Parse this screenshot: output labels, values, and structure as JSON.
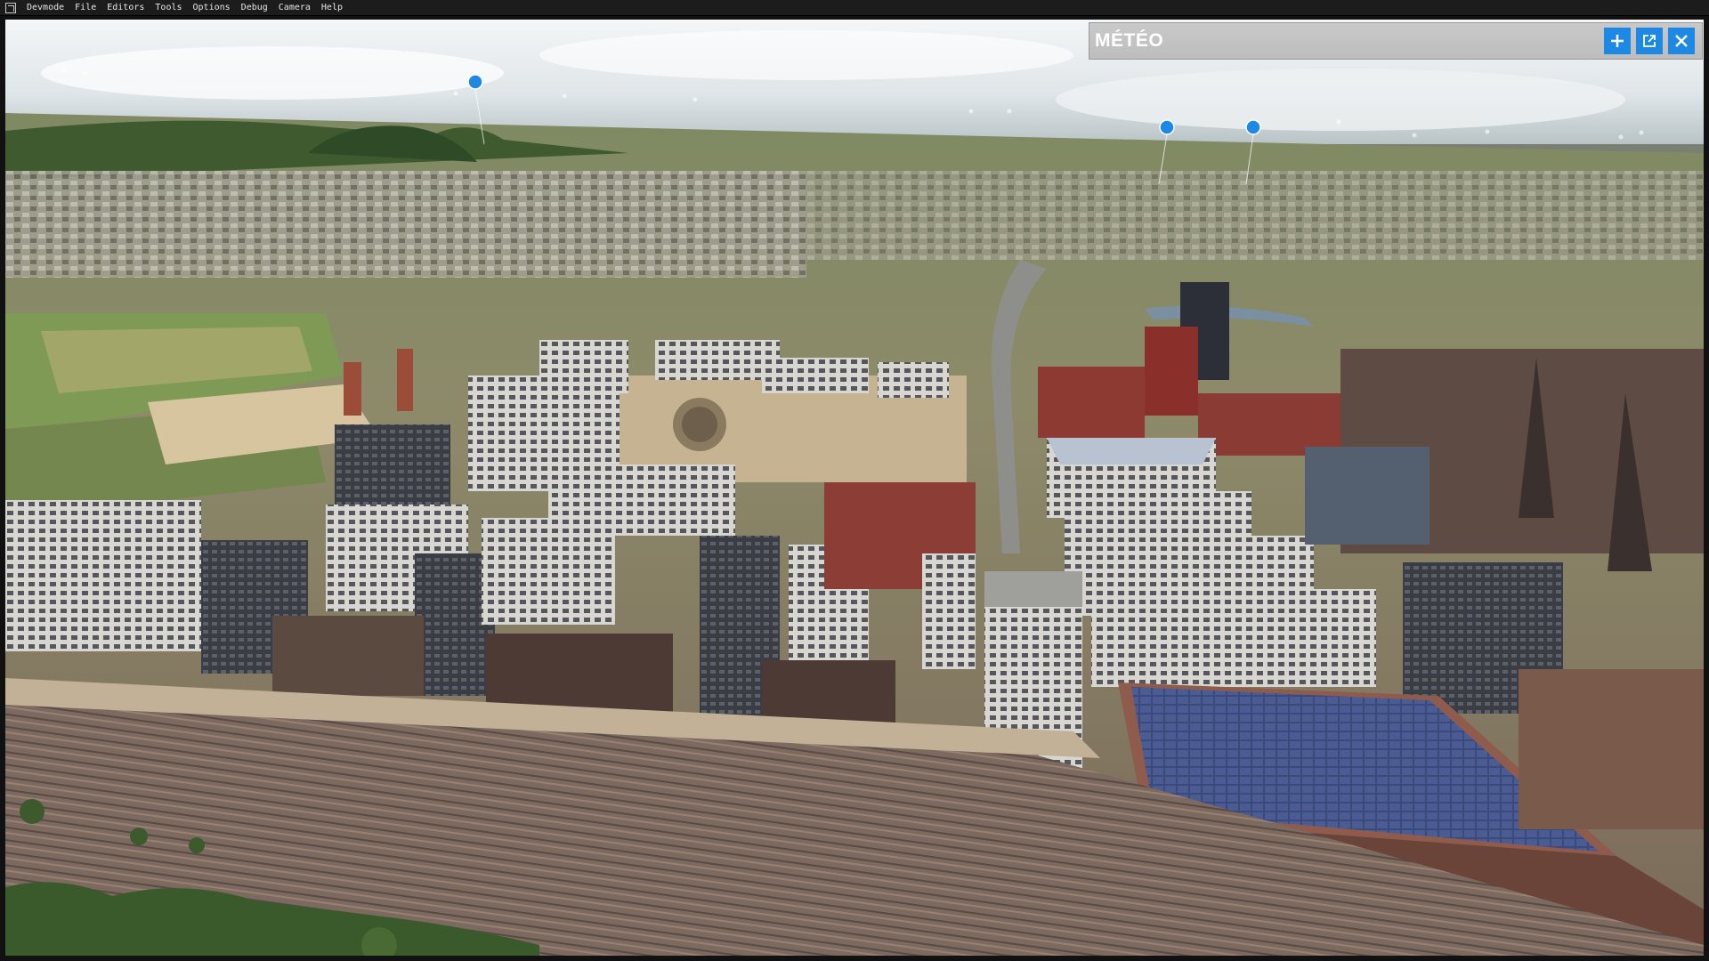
{
  "app": {
    "menu": [
      "Devmode",
      "File",
      "Editors",
      "Tools",
      "Options",
      "Debug",
      "Camera",
      "Help"
    ]
  },
  "panel": {
    "title": "MÉTÉO",
    "buttons": {
      "add": "plus-icon",
      "popout": "popout-icon",
      "close": "close-icon"
    },
    "accent": "#1e88e5"
  },
  "scene": {
    "description_icons": "poi-marker-icon",
    "sky": "#dfe6ea",
    "ground": "#8a8567"
  }
}
